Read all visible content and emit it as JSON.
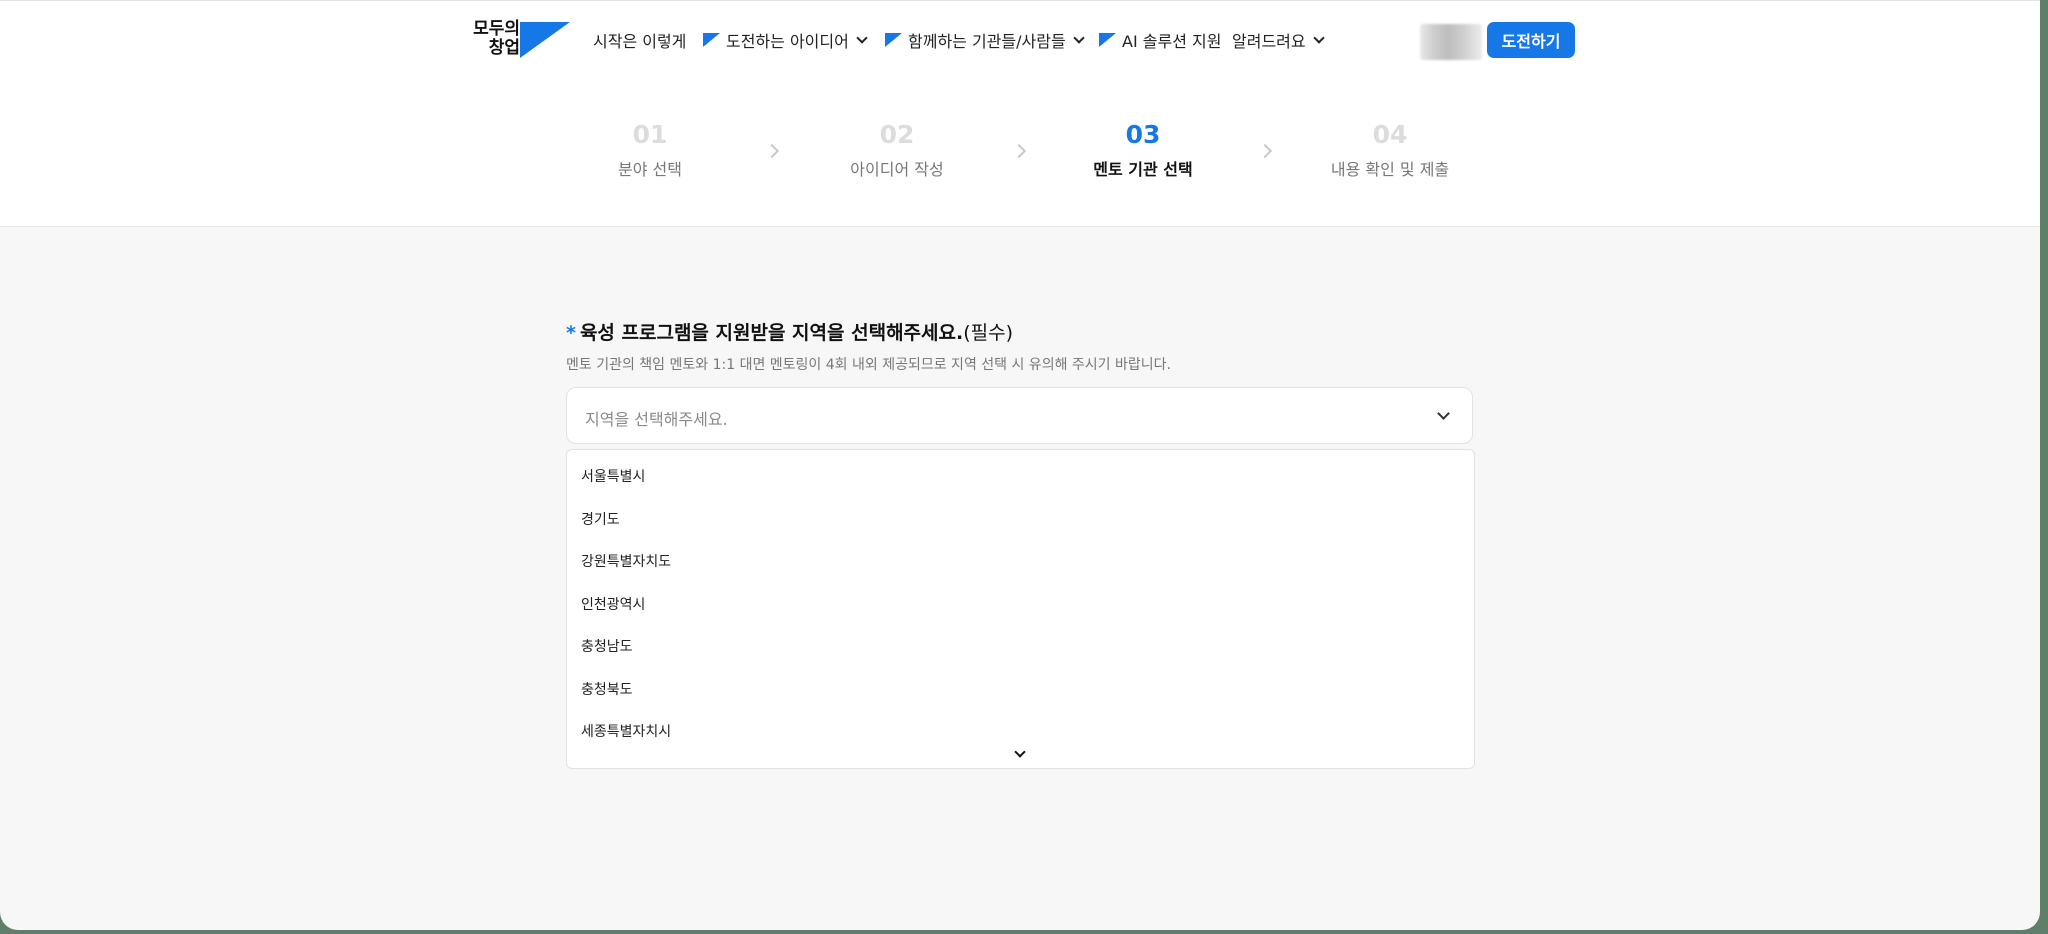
{
  "brand": {
    "logo_line1": "모두의",
    "logo_line2": "창업",
    "accent": "#1677e6"
  },
  "nav": {
    "items": [
      {
        "label": "시작은 이렇게",
        "flag": false,
        "dropdown": false
      },
      {
        "label": "도전하는 아이디어",
        "flag": true,
        "dropdown": true
      },
      {
        "label": "함께하는 기관들/사람들",
        "flag": true,
        "dropdown": true
      },
      {
        "label": "AI 솔루션 지원",
        "flag": true,
        "dropdown": false
      },
      {
        "label": "알려드려요",
        "flag": false,
        "dropdown": true
      }
    ],
    "cta_label": "도전하기"
  },
  "steps": [
    {
      "num": "01",
      "label": "분야 선택",
      "active": false
    },
    {
      "num": "02",
      "label": "아이디어 작성",
      "active": false
    },
    {
      "num": "03",
      "label": "멘토 기관 선택",
      "active": true
    },
    {
      "num": "04",
      "label": "내용 확인 및 제출",
      "active": false
    }
  ],
  "form": {
    "required_mark": "*",
    "question": "육성 프로그램을 지원받을 지역을 선택해주세요.",
    "required_note": "(필수)",
    "help": "멘토 기관의 책임 멘토와 1:1 대면 멘토링이 4회 내외 제공되므로 지역 선택 시 유의해 주시기 바랍니다.",
    "select_placeholder": "지역을 선택해주세요.",
    "options": [
      "서울특별시",
      "경기도",
      "강원특별자치도",
      "인천광역시",
      "충청남도",
      "충청북도",
      "세종특별자치시"
    ]
  }
}
